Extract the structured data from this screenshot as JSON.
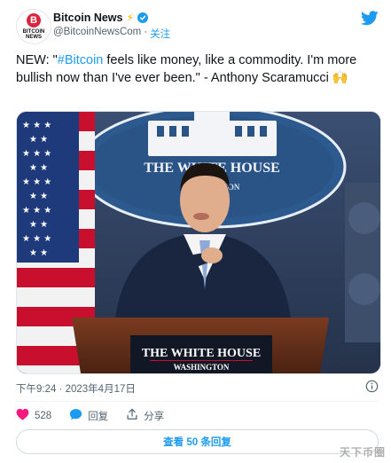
{
  "account": {
    "avatar_top": "B",
    "avatar_brand": "BITCOIN NEWS",
    "name": "Bitcoin News",
    "handle": "@BitcoinNewsCom",
    "separator": "·",
    "follow_label": "关注"
  },
  "tweet": {
    "prefix": "NEW: \"",
    "hashtag": "#Bitcoin",
    "body": "  feels like money, like a commodity. I'm more bullish now than I've ever been.\" - Anthony Scaramucci 🙌"
  },
  "photo": {
    "seal_text": "THE WHITE HOUSE",
    "seal_sub": "WASHINGTON",
    "podium_title": "THE WHITE HOUSE",
    "podium_sub": "WASHINGTON"
  },
  "meta": {
    "timestamp": "下午9:24 · 2023年4月17日"
  },
  "actions": {
    "likes": "528",
    "reply_label": "回复",
    "share_label": "分享"
  },
  "replies_button": "查看 50 条回复",
  "watermark": "天下币圈",
  "colors": {
    "accent": "#1d9bf0",
    "like": "#f91880",
    "verified": "#1d9bf0",
    "bolt": "#f4b400",
    "text": "#0f1419",
    "secondary": "#536471"
  }
}
